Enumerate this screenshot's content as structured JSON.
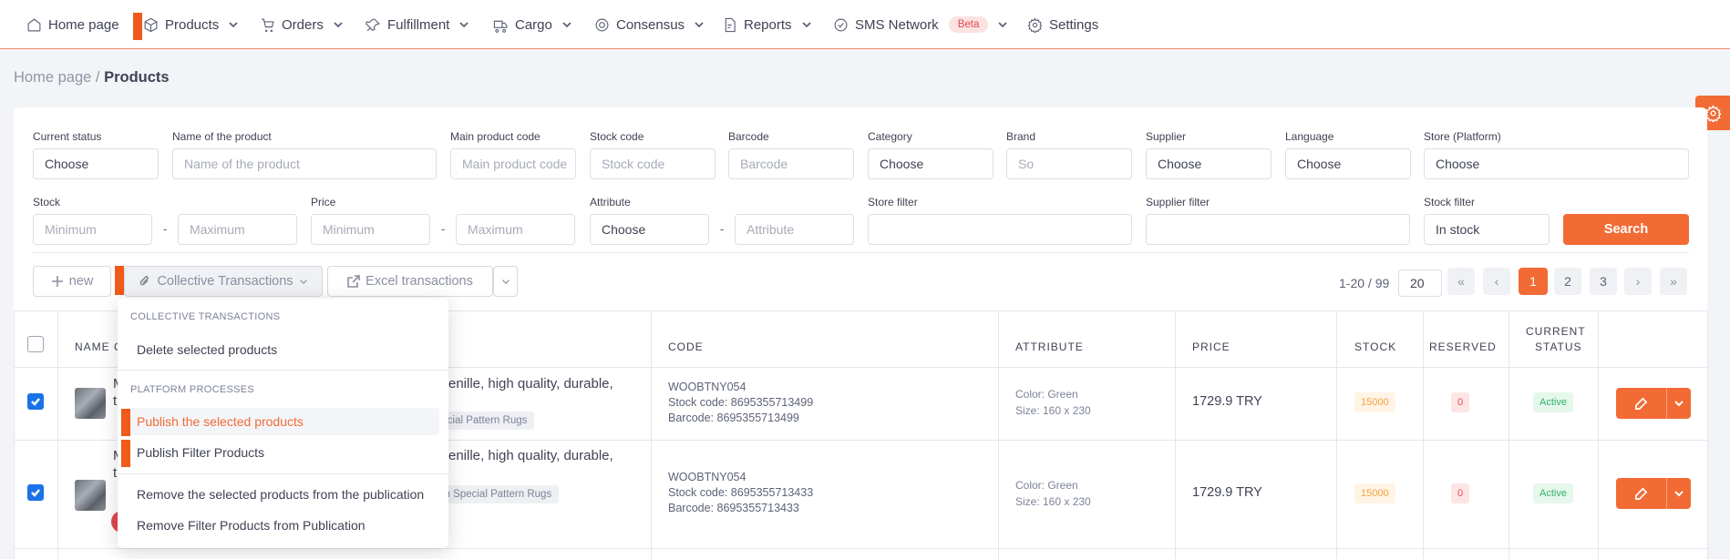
{
  "nav": {
    "items": [
      {
        "label": "Home page",
        "icon": "home-icon"
      },
      {
        "label": "Products",
        "icon": "box-icon"
      },
      {
        "label": "Orders",
        "icon": "cart-icon"
      },
      {
        "label": "Fulfillment",
        "icon": "pin-icon"
      },
      {
        "label": "Cargo",
        "icon": "truck-icon"
      },
      {
        "label": "Consensus",
        "icon": "target-icon"
      },
      {
        "label": "Reports",
        "icon": "report-icon"
      },
      {
        "label": "SMS Network",
        "icon": "check-circle-icon",
        "badge": "Beta"
      },
      {
        "label": "Settings",
        "icon": "gear-icon"
      }
    ]
  },
  "breadcrumb": {
    "home": "Home page /",
    "current": "Products"
  },
  "filters": {
    "current_status": {
      "label": "Current status",
      "value": "Choose"
    },
    "product_name": {
      "label": "Name of the product",
      "placeholder": "Name of the product"
    },
    "main_code": {
      "label": "Main product code",
      "placeholder": "Main product code"
    },
    "stock_code": {
      "label": "Stock code",
      "placeholder": "Stock code"
    },
    "barcode": {
      "label": "Barcode",
      "placeholder": "Barcode"
    },
    "category": {
      "label": "Category",
      "value": "Choose"
    },
    "brand": {
      "label": "Brand",
      "placeholder": "So"
    },
    "supplier": {
      "label": "Supplier",
      "value": "Choose"
    },
    "language": {
      "label": "Language",
      "value": "Choose"
    },
    "store": {
      "label": "Store (Platform)",
      "value": "Choose"
    },
    "stock": {
      "label": "Stock",
      "min": "Minimum",
      "max": "Maximum"
    },
    "price": {
      "label": "Price",
      "min": "Minimum",
      "max": "Maximum"
    },
    "attribute": {
      "label": "Attribute",
      "value": "Choose",
      "placeholder": "Attribute"
    },
    "store_filter": {
      "label": "Store filter"
    },
    "supplier_filter": {
      "label": "Supplier filter"
    },
    "stock_filter": {
      "label": "Stock filter",
      "value": "In stock"
    },
    "dash": "-",
    "search_label": "Search"
  },
  "toolbar": {
    "new_label": "new",
    "collective_label": "Collective Transactions",
    "excel_label": "Excel transactions"
  },
  "pagination": {
    "info": "1-20 / 99",
    "per_page": "20",
    "first": "«",
    "prev": "‹",
    "pages": [
      "1",
      "2",
      "3"
    ],
    "next": "›",
    "last": "»",
    "active_page": "1"
  },
  "table": {
    "headers": {
      "name": "NAME O",
      "code": "CODE",
      "attribute": "ATTRIBUTE",
      "price": "PRICE",
      "stock": "STOCK",
      "reserved": "RESERVED",
      "status_line1": "CURRENT",
      "status_line2": "STATUS"
    },
    "rows": [
      {
        "name_start": "M",
        "name_mid": "t",
        "name_right": "enille, high quality, durable,",
        "tag": "pecial Pattern Rugs",
        "code": "WOOBTNY054",
        "stock_code": "Stock code: 8695355713499",
        "barcode": "Barcode: 8695355713499",
        "color": "Color: Green",
        "size": "Size: 160 x 230",
        "price": "1729.9 TRY",
        "stock": "15000",
        "reserved": "0",
        "status": "Active",
        "checked": true
      },
      {
        "name_start": "M",
        "name_mid": "t",
        "name_right": "enille, high quality, durable,",
        "tag": "um Special Pattern Rugs",
        "code": "WOOBTNY054",
        "stock_code": "Stock code: 8695355713433",
        "barcode": "Barcode: 8695355713433",
        "color": "Color: Green",
        "size": "Size: 160 x 230",
        "price": "1729.9 TRY",
        "stock": "15000",
        "reserved": "0",
        "status": "Active",
        "checked": true
      }
    ]
  },
  "menu": {
    "section1": "COLLECTIVE TRANSACTIONS",
    "delete": "Delete selected products",
    "section2": "PLATFORM PROCESSES",
    "publish_selected": "Publish the selected products",
    "publish_filter": "Publish Filter Products",
    "remove_selected": "Remove the selected products from the publication",
    "remove_filter": "Remove Filter Products from Publication"
  },
  "colors": {
    "accent": "#f26b35",
    "marker": "#f05a1a",
    "checkbox": "#1a73e8"
  }
}
